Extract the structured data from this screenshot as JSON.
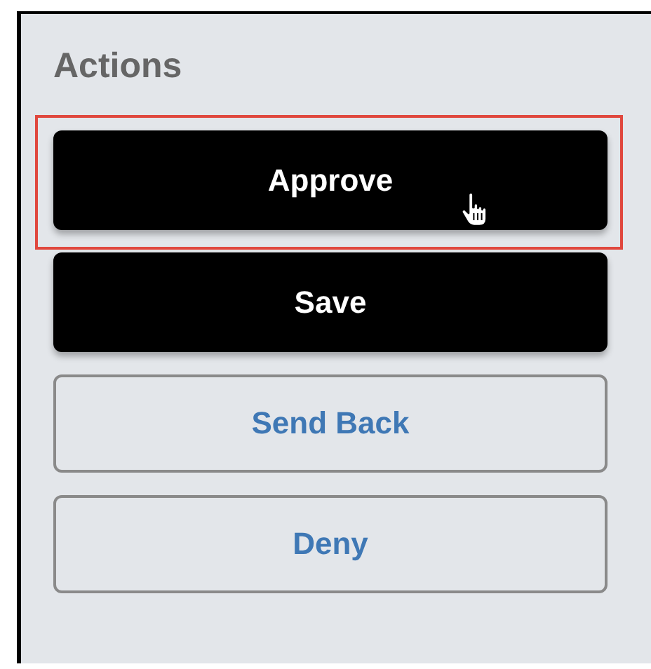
{
  "panel": {
    "title": "Actions"
  },
  "buttons": [
    {
      "label": "Approve",
      "kind": "primary",
      "highlighted": true,
      "hovered": true
    },
    {
      "label": "Save",
      "kind": "primary",
      "highlighted": false,
      "hovered": false
    },
    {
      "label": "Send Back",
      "kind": "secondary",
      "highlighted": false,
      "hovered": false
    },
    {
      "label": "Deny",
      "kind": "secondary",
      "highlighted": false,
      "hovered": false
    }
  ]
}
